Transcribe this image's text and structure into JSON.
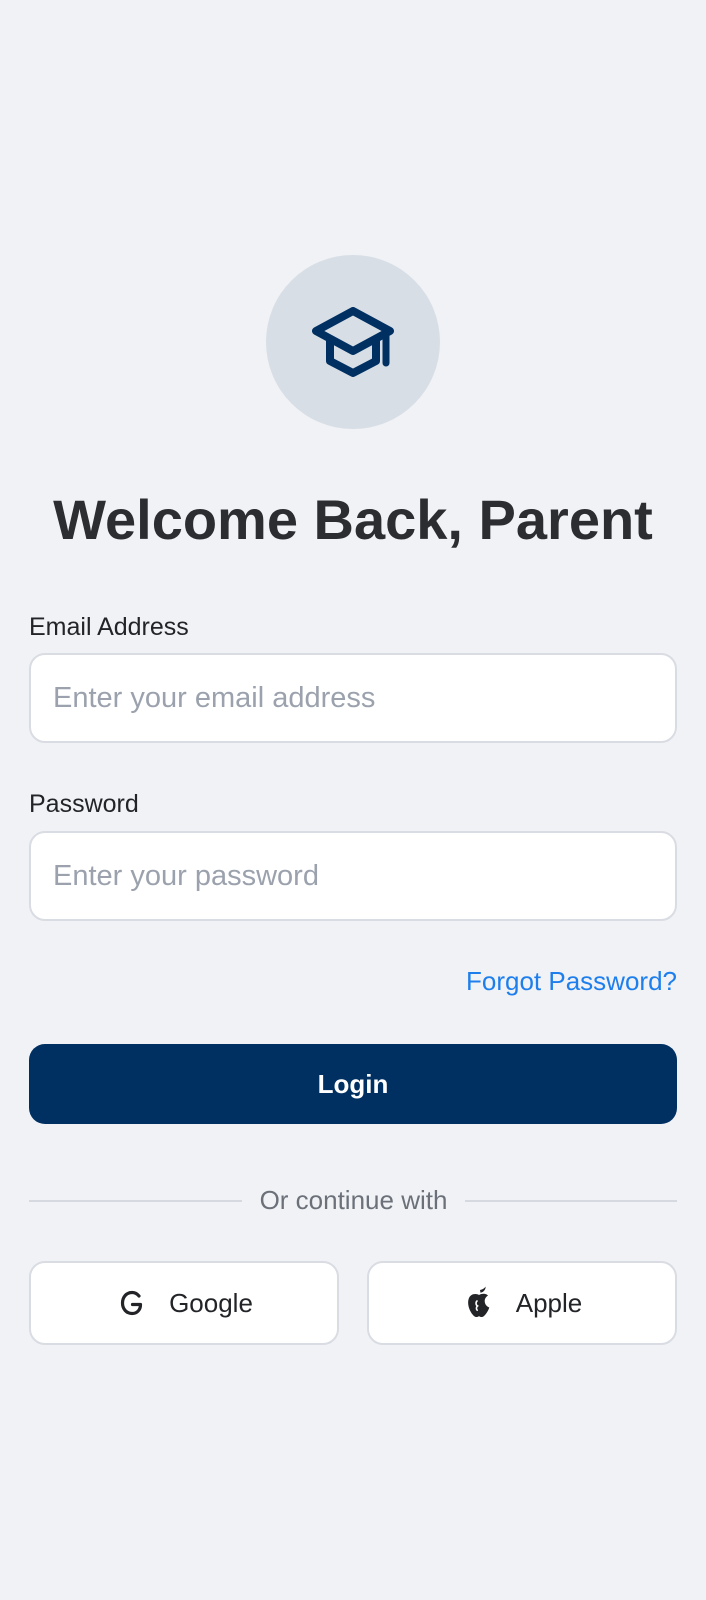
{
  "logo": {
    "icon": "graduation-cap-icon",
    "color": "#003062",
    "background": "#d8dee6"
  },
  "title": "Welcome Back, Parent",
  "email": {
    "label": "Email Address",
    "placeholder": "Enter your email address",
    "value": ""
  },
  "password": {
    "label": "Password",
    "placeholder": "Enter your password",
    "value": ""
  },
  "forgot_password": "Forgot Password?",
  "login_button": "Login",
  "divider_text": "Or continue with",
  "social": {
    "google": {
      "label": "Google",
      "icon": "google-icon"
    },
    "apple": {
      "label": "Apple",
      "icon": "apple-icon"
    }
  },
  "colors": {
    "primary": "#003062",
    "link": "#1e7fec",
    "background": "#f0f2f6"
  }
}
